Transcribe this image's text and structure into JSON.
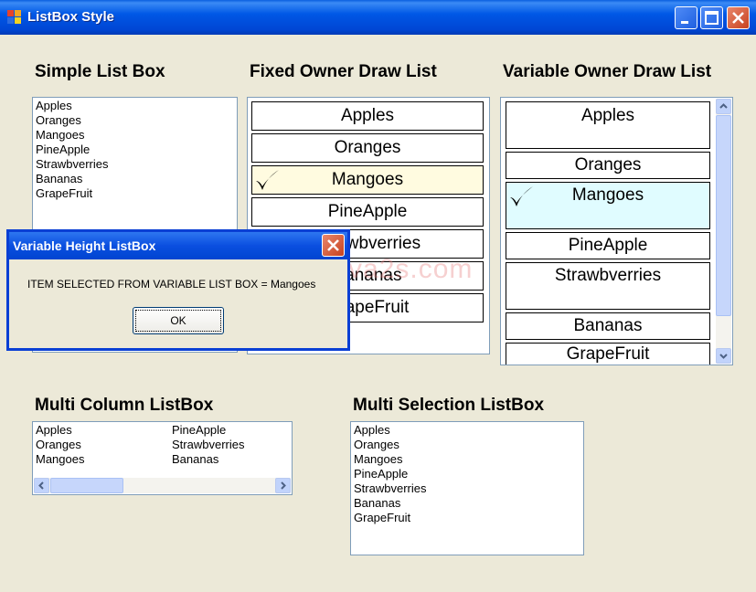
{
  "window": {
    "title": "ListBox Style"
  },
  "titlebar_buttons": {
    "minimize": "minimize-icon",
    "maximize": "maximize-icon",
    "close": "close-icon"
  },
  "labels": {
    "simple": "Simple List Box",
    "fixed": "Fixed Owner Draw List",
    "variable": "Variable Owner Draw  List",
    "multicolumn": "Multi Column ListBox",
    "multiselection": "Multi Selection ListBox"
  },
  "items": [
    "Apples",
    "Oranges",
    "Mangoes",
    "PineApple",
    "Strawbverries",
    "Bananas",
    "GrapeFruit"
  ],
  "fixed_list": {
    "selected": "Mangoes",
    "selected_bg": "#fffbe0",
    "check_icon": "checkmark-icon"
  },
  "variable_list": {
    "selected": "Mangoes",
    "selected_bg": "#e0fcff",
    "check_icon": "checkmark-icon"
  },
  "multi_column": {
    "col1": [
      "Apples",
      "Oranges",
      "Mangoes"
    ],
    "col2": [
      "PineApple",
      "Strawbverries",
      "Bananas"
    ]
  },
  "dialog": {
    "title": "Variable Height ListBox",
    "message": "ITEM SELECTED FROM  VARIABLE LIST BOX = Mangoes",
    "ok_label": "OK"
  },
  "watermark": "www.java2s.com"
}
